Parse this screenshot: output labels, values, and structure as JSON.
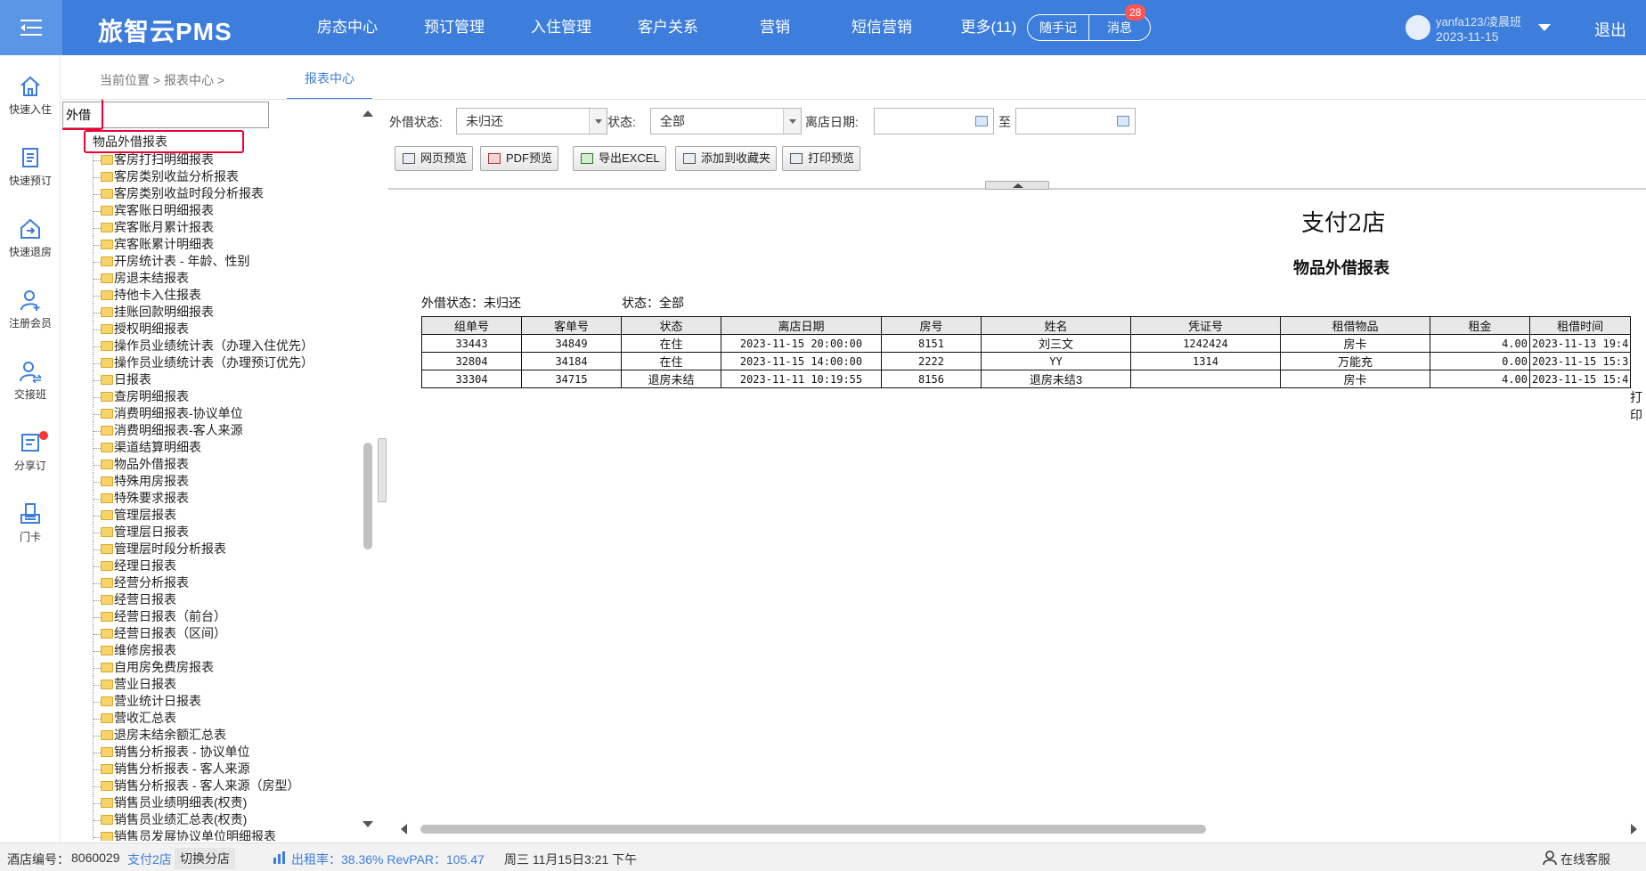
{
  "app": {
    "brand": "旅智云PMS"
  },
  "nav": {
    "items": [
      "房态中心",
      "预订管理",
      "入住管理",
      "客户关系",
      "营销",
      "短信营销",
      "更多(11)"
    ],
    "memo_label": "随手记",
    "message_label": "消息",
    "message_count": "28"
  },
  "user": {
    "name": "yanfa123/凌晨班",
    "date": "2023-11-15",
    "logout": "退出"
  },
  "sidebar": {
    "items": [
      {
        "label": "快速入住",
        "icon": "home-icon"
      },
      {
        "label": "快速预订",
        "icon": "clipboard-icon"
      },
      {
        "label": "快速退房",
        "icon": "checkout-house-icon"
      },
      {
        "label": "注册会员",
        "icon": "add-user-icon"
      },
      {
        "label": "交接班",
        "icon": "handover-user-icon"
      },
      {
        "label": "分享订",
        "icon": "share-order-icon"
      },
      {
        "label": "门卡",
        "icon": "door-card-icon"
      }
    ]
  },
  "breadcrumb": {
    "prefix": "当前位置",
    "section": "报表中心",
    "sep": ">"
  },
  "tabs": {
    "active": "报表中心"
  },
  "tree": {
    "search_value": "外借",
    "search_result": "物品外借报表",
    "items": [
      "客房打扫明细报表",
      "客房类别收益分析报表",
      "客房类别收益时段分析报表",
      "宾客账日明细报表",
      "宾客账月累计报表",
      "宾客账累计明细表",
      "开房统计表 - 年龄、性别",
      "房退未结报表",
      "持他卡入住报表",
      "挂账回款明细报表",
      "授权明细报表",
      "操作员业绩统计表（办理入住优先）",
      "操作员业绩统计表（办理预订优先）",
      "日报表",
      "查房明细报表",
      "消费明细报表-协议单位",
      "消费明细报表-客人来源",
      "渠道结算明细表",
      "物品外借报表",
      "特殊用房报表",
      "特殊要求报表",
      "管理层报表",
      "管理层日报表",
      "管理层时段分析报表",
      "经理日报表",
      "经营分析报表",
      "经营日报表",
      "经营日报表（前台）",
      "经营日报表（区间）",
      "维修房报表",
      "自用房免费房报表",
      "营业日报表",
      "营业统计日报表",
      "营收汇总表",
      "退房未结余额汇总表",
      "销售分析报表 - 协议单位",
      "销售分析报表 - 客人来源",
      "销售分析报表 - 客人来源（房型）",
      "销售员业绩明细表(权责)",
      "销售员业绩汇总表(权责)",
      "销售员发展协议单位明细报表"
    ]
  },
  "filters": {
    "lend_status_label": "外借状态:",
    "lend_status_value": "未归还",
    "status_label": "状态:",
    "status_value": "全部",
    "leave_date_label": "离店日期:",
    "to_label": "至"
  },
  "toolbar": {
    "web_preview": "网页预览",
    "pdf_preview": "PDF预览",
    "export_excel": "导出EXCEL",
    "add_favorite": "添加到收藏夹",
    "print_preview": "打印预览"
  },
  "report": {
    "store": "支付2店",
    "title": "物品外借报表",
    "filter_lend": "外借状态：未归还",
    "filter_status": "状态：全部",
    "columns": [
      "组单号",
      "客单号",
      "状态",
      "离店日期",
      "房号",
      "姓名",
      "凭证号",
      "租借物品",
      "租金",
      "租借时间"
    ],
    "rows": [
      [
        "33443",
        "34849",
        "在住",
        "2023-11-15 20:00:00",
        "8151",
        "刘三文",
        "1242424",
        "房卡",
        "4.00",
        "2023-11-13 19:4"
      ],
      [
        "32804",
        "34184",
        "在住",
        "2023-11-15 14:00:00",
        "2222",
        "YY",
        "1314",
        "万能充",
        "0.00",
        "2023-11-15 15:3"
      ],
      [
        "33304",
        "34715",
        "退房未结",
        "2023-11-11 10:19:55",
        "8156",
        "退房未结3",
        "",
        "房卡",
        "4.00",
        "2023-11-15 15:4"
      ]
    ],
    "print_note": "打印"
  },
  "status": {
    "hotel_no_label": "酒店编号：",
    "hotel_no": "8060029",
    "store_name": "支付2店",
    "switch_store": "切换分店",
    "occupancy": "出租率：38.36% RevPAR：105.47",
    "datetime": "周三 11月15日3:21 下午",
    "service": "在线客服"
  }
}
